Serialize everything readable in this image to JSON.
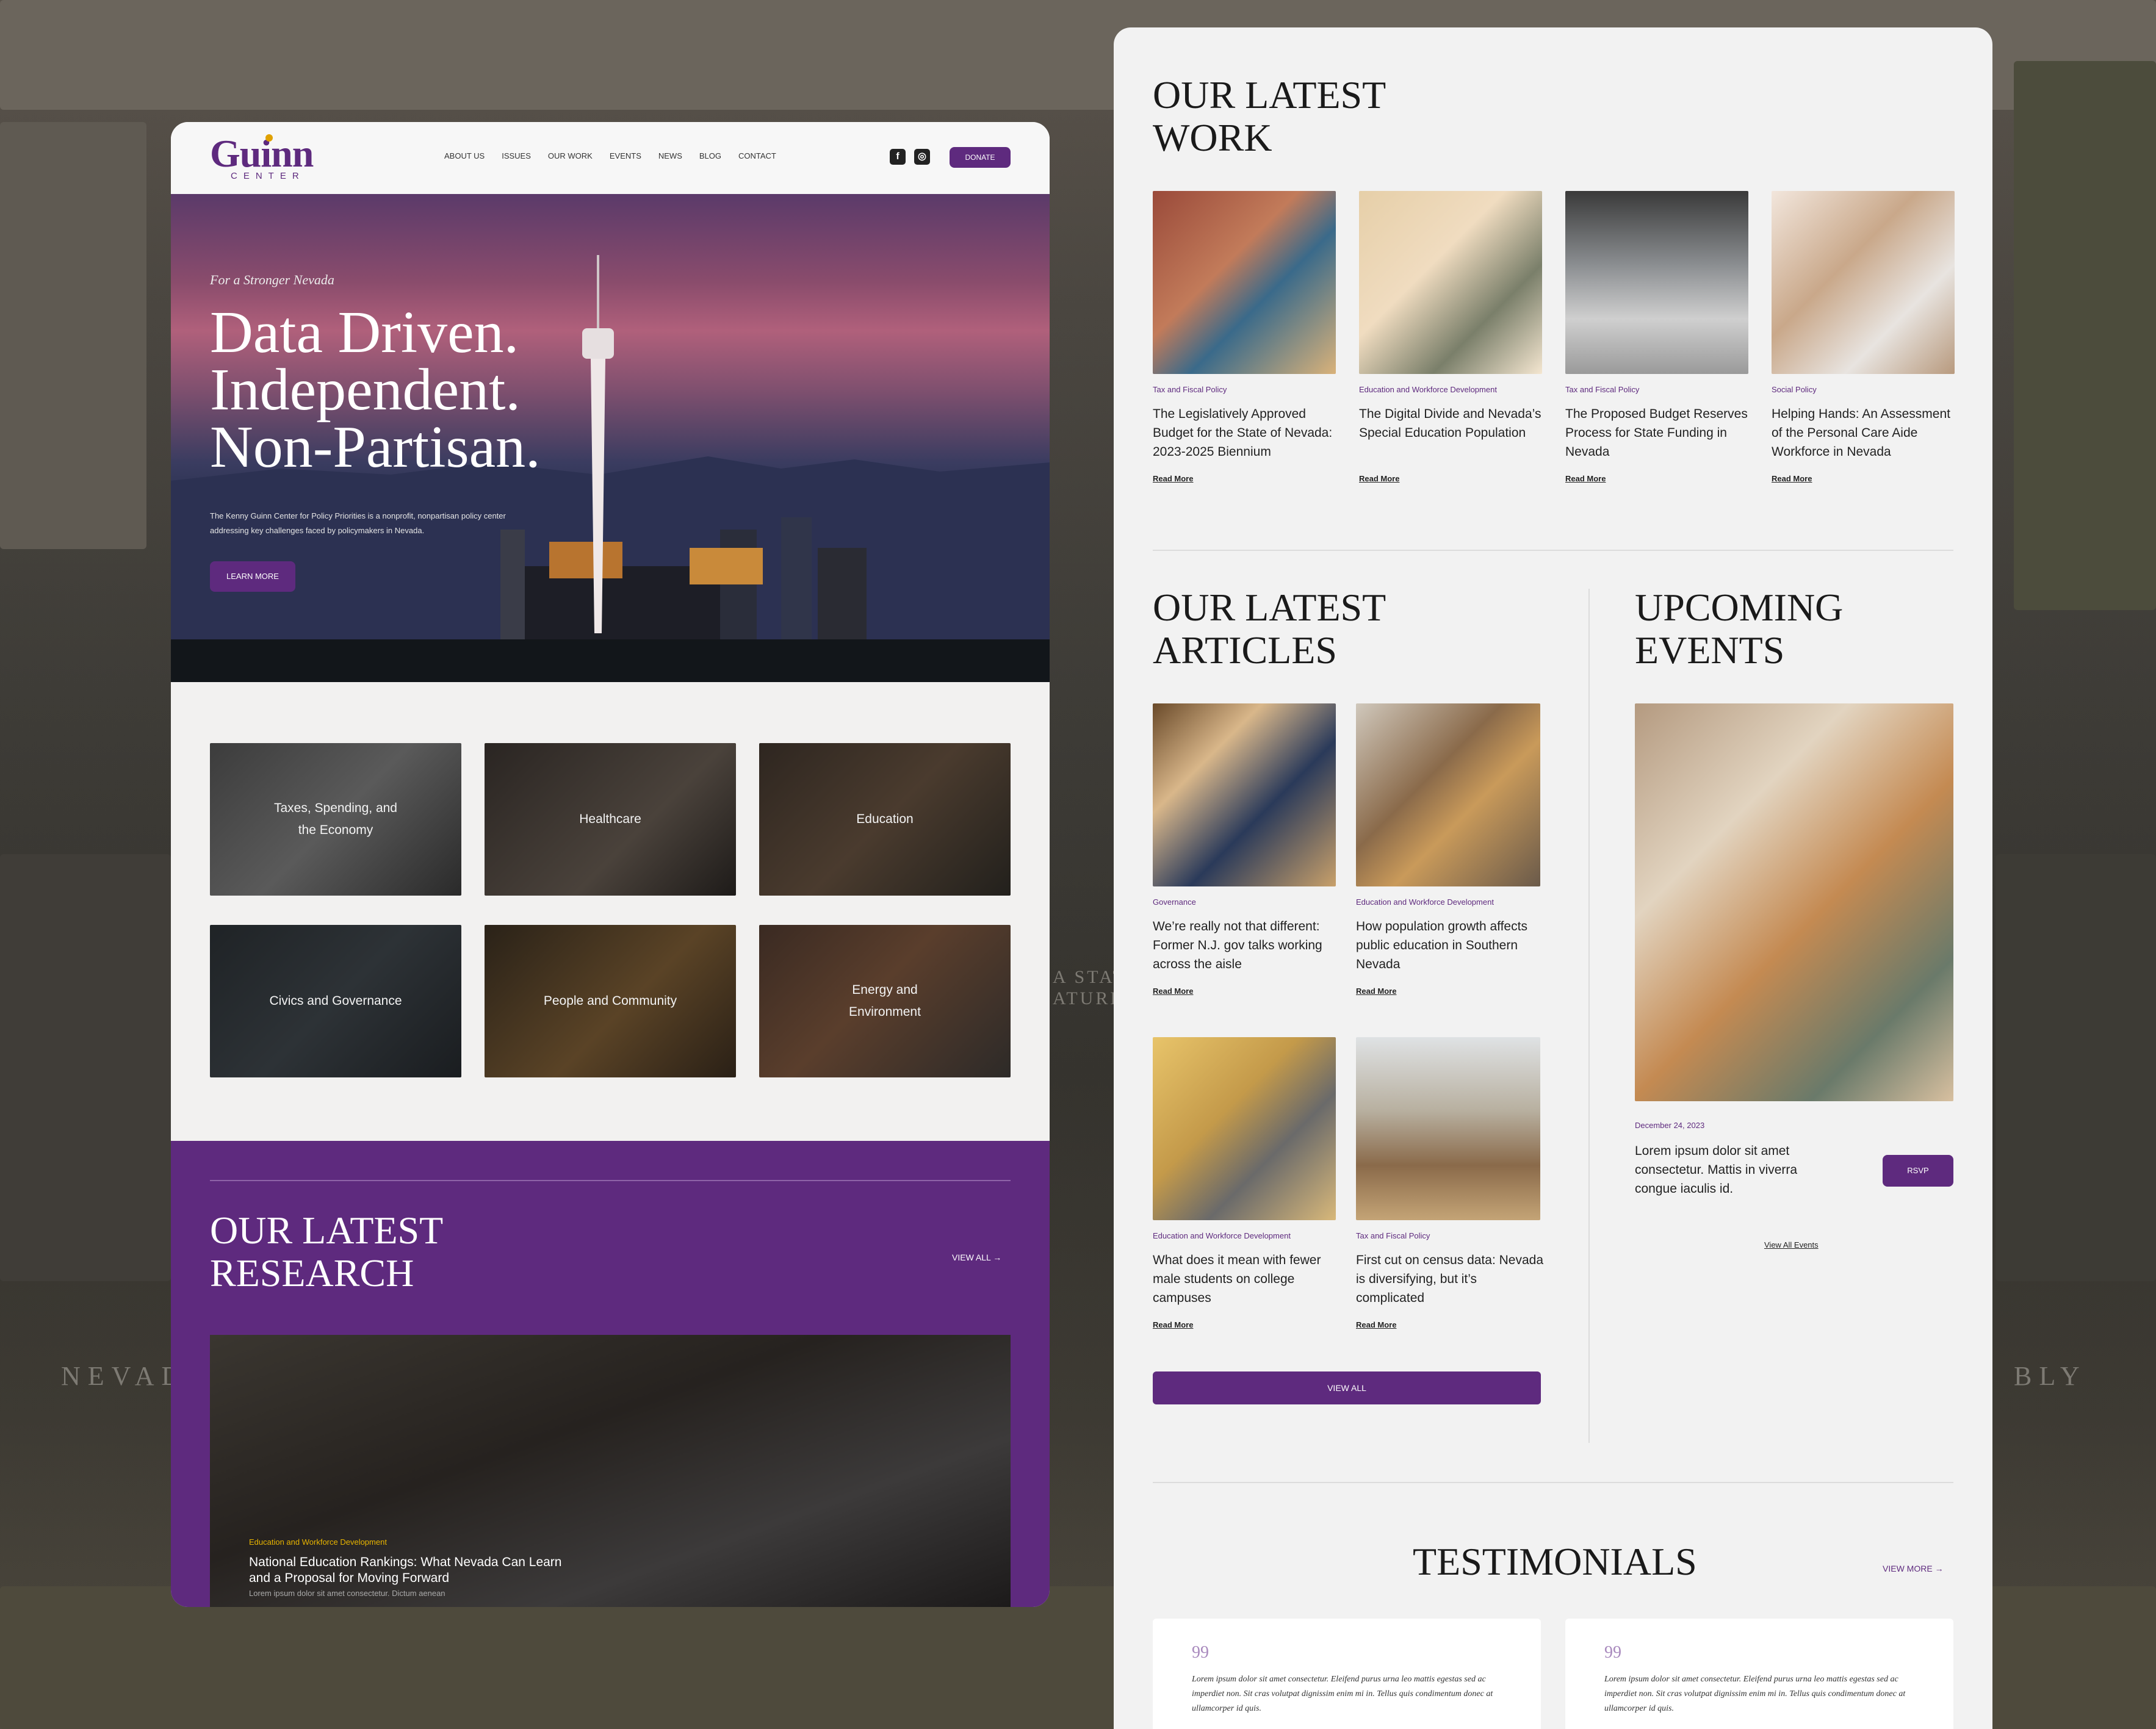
{
  "header": {
    "logo": "Guinn",
    "logo_sub": "CENTER",
    "nav": [
      "ABOUT US",
      "ISSUES",
      "OUR WORK",
      "EVENTS",
      "NEWS",
      "BLOG",
      "CONTACT"
    ],
    "social": {
      "facebook": "f",
      "instagram": "◎"
    },
    "donate": "DONATE"
  },
  "hero": {
    "kicker": "For a Stronger Nevada",
    "headline": "Data Driven. Independent. Non-Partisan.",
    "description": "The Kenny Guinn Center for Policy Priorities is a nonprofit, nonpartisan policy center addressing key challenges faced by policymakers in Nevada.",
    "cta": "LEARN MORE"
  },
  "issues": [
    "Taxes, Spending, and the Economy",
    "Healthcare",
    "Education",
    "Civics and Governance",
    "People and Community",
    "Energy and Environment"
  ],
  "research": {
    "title": "OUR LATEST RESEARCH",
    "view_all": "VIEW ALL",
    "featured": {
      "category": "Education and Workforce Development",
      "title": "National Education Rankings: What Nevada Can Learn and a Proposal for Moving Forward",
      "excerpt": "Lorem ipsum dolor sit amet consectetur. Dictum aenean"
    }
  },
  "latest_work": {
    "title": "OUR LATEST WORK",
    "items": [
      {
        "category": "Tax and Fiscal Policy",
        "title": "The Legislatively Approved Budget for the State of Nevada: 2023-2025 Biennium",
        "more": "Read More"
      },
      {
        "category": "Education and Workforce Development",
        "title": "The Digital Divide and Nevada’s Special Education Population",
        "more": "Read More"
      },
      {
        "category": "Tax and Fiscal Policy",
        "title": "The Proposed Budget Reserves Process for State Funding in Nevada",
        "more": "Read More"
      },
      {
        "category": "Social Policy",
        "title": "Helping Hands: An Assessment of the Personal Care Aide Workforce in Nevada",
        "more": "Read More"
      }
    ]
  },
  "articles": {
    "title": "OUR LATEST ARTICLES",
    "view_all": "VIEW ALL",
    "items": [
      {
        "category": "Governance",
        "title": "We’re really not that different: Former N.J. gov talks working across the aisle",
        "more": "Read More"
      },
      {
        "category": "Education and Workforce Development",
        "title": "How population growth affects public education in Southern Nevada",
        "more": "Read More"
      },
      {
        "category": "Education and Workforce Development",
        "title": "What does it mean with fewer male students on college campuses",
        "more": "Read More"
      },
      {
        "category": "Tax and Fiscal Policy",
        "title": "First cut on census data: Nevada is diversifying, but it’s complicated",
        "more": "Read More"
      }
    ]
  },
  "events": {
    "title": "UPCOMING EVENTS",
    "date": "December 24, 2023",
    "description": "Lorem ipsum dolor sit amet consectetur. Mattis in viverra congue iaculis id.",
    "rsvp": "RSVP",
    "view_all": "View All Events"
  },
  "testimonials": {
    "title": "TESTIMONIALS",
    "view_more": "VIEW MORE",
    "quote_mark": "99",
    "items": [
      "Lorem ipsum dolor sit amet consectetur. Eleifend purus urna leo mattis egestas sed ac imperdiet non. Sit cras volutpat dignissim enim mi in. Tellus quis condimentum donec at ullamcorper id quis.",
      "Lorem ipsum dolor sit amet consectetur. Eleifend purus urna leo mattis egestas sed ac imperdiet non. Sit cras volutpat dignissim enim mi in. Tellus quis condimentum donec at ullamcorper id quis."
    ]
  },
  "background": {
    "left_sign": "NEVAD",
    "right_sign": "BLY",
    "mid_sign_1": "A STAT",
    "mid_sign_2": "ATURE"
  }
}
